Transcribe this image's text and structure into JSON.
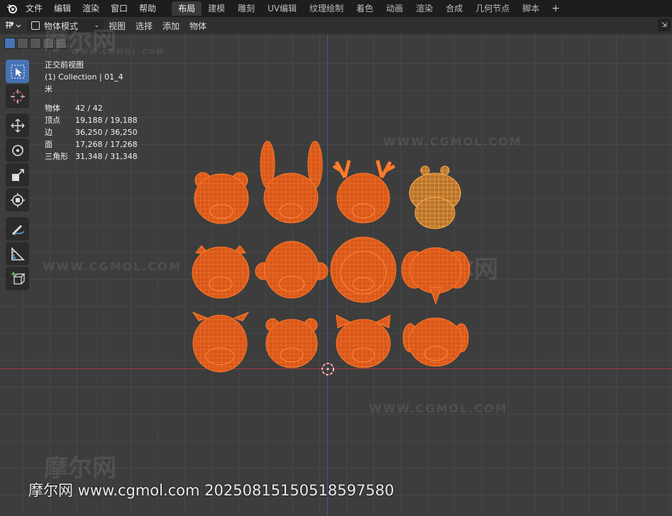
{
  "topbar": {
    "menus": [
      "文件",
      "编辑",
      "渲染",
      "窗口",
      "帮助"
    ],
    "workspaces": [
      "布局",
      "建模",
      "雕刻",
      "UV编辑",
      "纹理绘制",
      "着色",
      "动画",
      "渲染",
      "合成",
      "几何节点",
      "脚本"
    ],
    "active_workspace": "布局",
    "add_tab": "+"
  },
  "header": {
    "mode": "物体模式",
    "menus": [
      "视图",
      "选择",
      "添加",
      "物体"
    ]
  },
  "overlay": {
    "view_name": "正交前视图",
    "collection": "(1) Collection | 01_4",
    "unit": "米",
    "stats": [
      {
        "label": "物体",
        "value": "42 / 42"
      },
      {
        "label": "顶点",
        "value": "19,188 / 19,188"
      },
      {
        "label": "边",
        "value": "36,250 / 36,250"
      },
      {
        "label": "面",
        "value": "17,268 / 17,268"
      },
      {
        "label": "三角形",
        "value": "31,348 / 31,348"
      }
    ]
  },
  "watermarks": {
    "site": "WWW.CGMOL.COM",
    "site_cn": "摩尔网",
    "footer": "摩尔网 www.cgmol.com 20250815150518597580"
  },
  "colors": {
    "wire_selected": "#e8621a",
    "wire_active": "#ffaa40",
    "x_axis": "#9a3a44",
    "y_axis": "#3c5c8c",
    "accent": "#4772b3"
  }
}
